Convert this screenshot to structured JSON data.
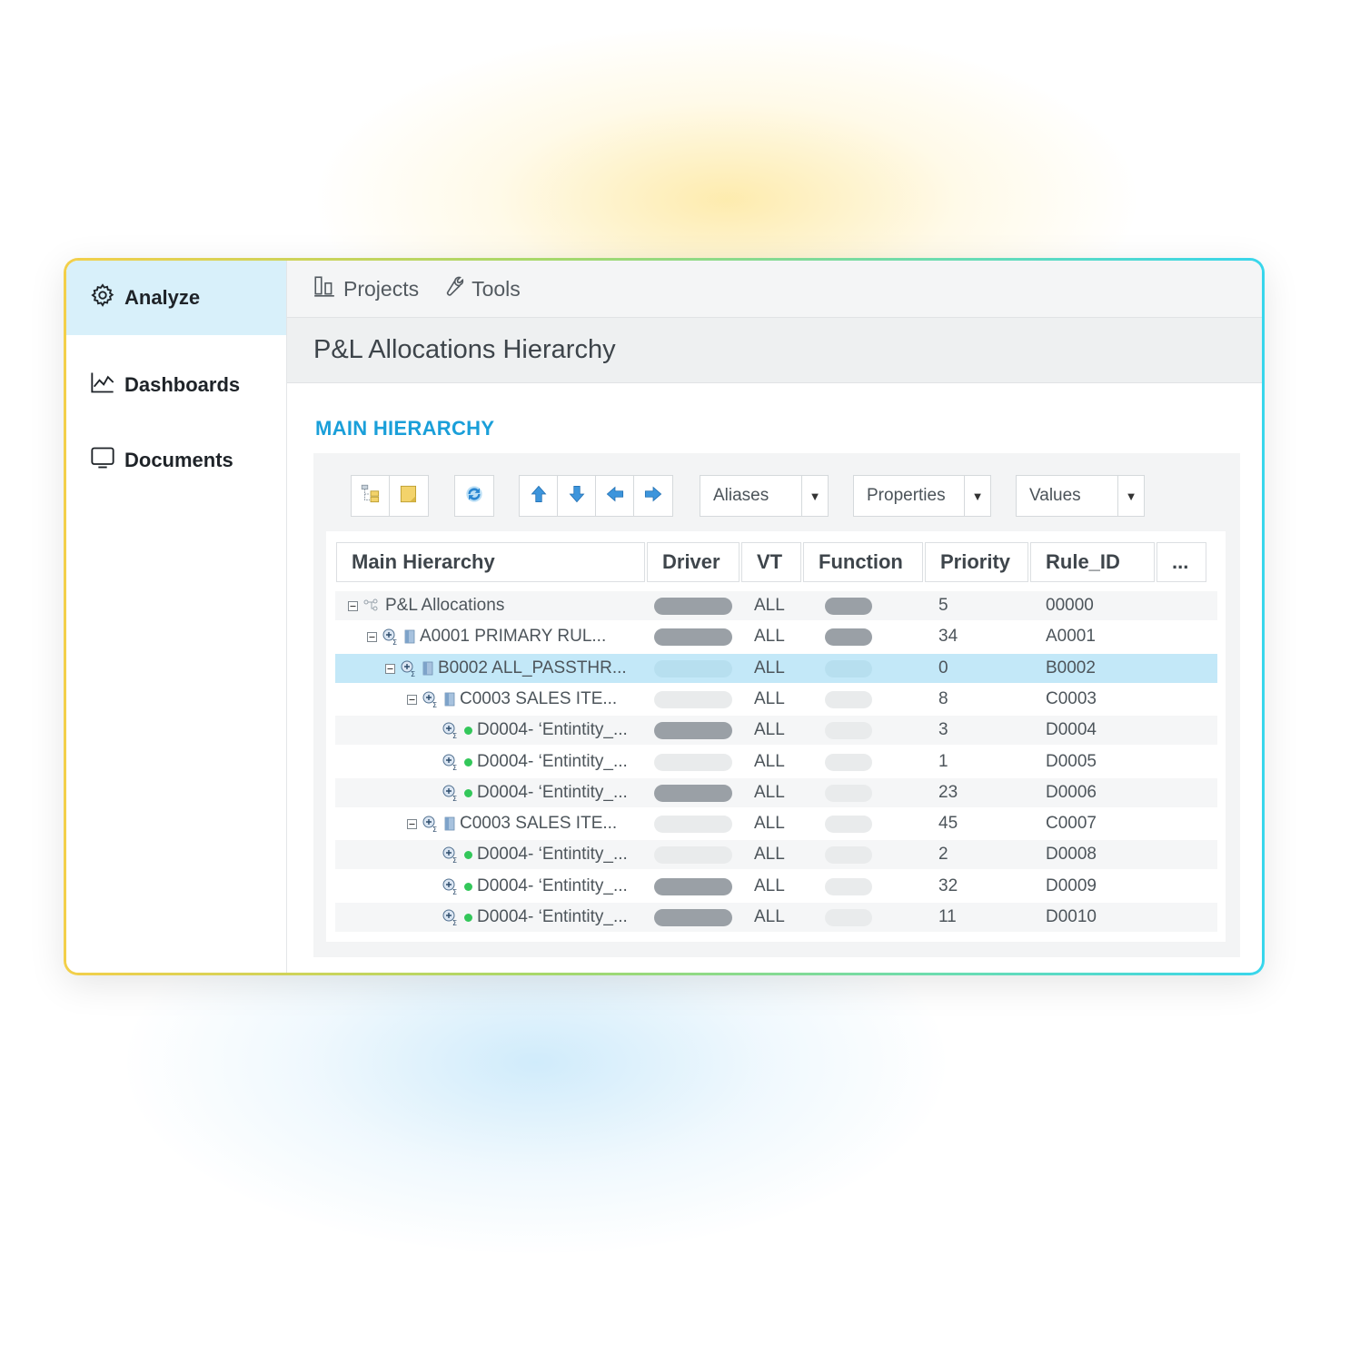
{
  "sidebar": {
    "items": [
      {
        "label": "Analyze",
        "icon": "gear-icon",
        "active": true
      },
      {
        "label": "Dashboards",
        "icon": "line-chart-icon",
        "active": false
      },
      {
        "label": "Documents",
        "icon": "monitor-icon",
        "active": false
      }
    ]
  },
  "topnav": {
    "projects": "Projects",
    "tools": "Tools"
  },
  "page": {
    "title": "P&L Allocations Hierarchy",
    "section": "MAIN HIERARCHY"
  },
  "toolbar": {
    "aliases": "Aliases",
    "properties": "Properties",
    "values": "Values"
  },
  "table": {
    "headers": [
      "Main Hierarchy",
      "Driver",
      "VT",
      "Function",
      "Priority",
      "Rule_ID",
      "..."
    ],
    "rows": [
      {
        "name": "P&L Allocations",
        "level": 0,
        "driver": "dark",
        "vt": "ALL",
        "function": "dark",
        "priority": "5",
        "rule_id": "00000",
        "selected": false
      },
      {
        "name": "A0001 PRIMARY RUL...",
        "level": 1,
        "driver": "dark",
        "vt": "ALL",
        "function": "dark",
        "priority": "34",
        "rule_id": "A0001",
        "selected": false
      },
      {
        "name": "B0002 ALL_PASSTHR...",
        "level": 2,
        "driver": "light",
        "vt": "ALL",
        "function": "light",
        "priority": "0",
        "rule_id": "B0002",
        "selected": true
      },
      {
        "name": "C0003 SALES ITE...",
        "level": 3,
        "driver": "light",
        "vt": "ALL",
        "function": "light",
        "priority": "8",
        "rule_id": "C0003",
        "selected": false
      },
      {
        "name": "D0004- ‘Entintity_...",
        "level": 4,
        "driver": "dark",
        "vt": "ALL",
        "function": "light",
        "priority": "3",
        "rule_id": "D0004",
        "selected": false
      },
      {
        "name": "D0004- ‘Entintity_...",
        "level": 4,
        "driver": "light",
        "vt": "ALL",
        "function": "light",
        "priority": "1",
        "rule_id": "D0005",
        "selected": false
      },
      {
        "name": "D0004- ‘Entintity_...",
        "level": 4,
        "driver": "dark",
        "vt": "ALL",
        "function": "light",
        "priority": "23",
        "rule_id": "D0006",
        "selected": false
      },
      {
        "name": "C0003 SALES ITE...",
        "level": 3,
        "driver": "light",
        "vt": "ALL",
        "function": "light",
        "priority": "45",
        "rule_id": "C0007",
        "selected": false
      },
      {
        "name": "D0004- ‘Entintity_...",
        "level": 4,
        "driver": "light",
        "vt": "ALL",
        "function": "light",
        "priority": "2",
        "rule_id": "D0008",
        "selected": false
      },
      {
        "name": "D0004- ‘Entintity_...",
        "level": 4,
        "driver": "dark",
        "vt": "ALL",
        "function": "light",
        "priority": "32",
        "rule_id": "D0009",
        "selected": false
      },
      {
        "name": "D0004- ‘Entintity_...",
        "level": 4,
        "driver": "dark",
        "vt": "ALL",
        "function": "light",
        "priority": "11",
        "rule_id": "D0010",
        "selected": false
      }
    ]
  },
  "colors": {
    "accent": "#1a9fd9",
    "active_nav": "#d8f0fa",
    "selected_row": "#c3e8f8",
    "status_dot": "#33c75a"
  }
}
